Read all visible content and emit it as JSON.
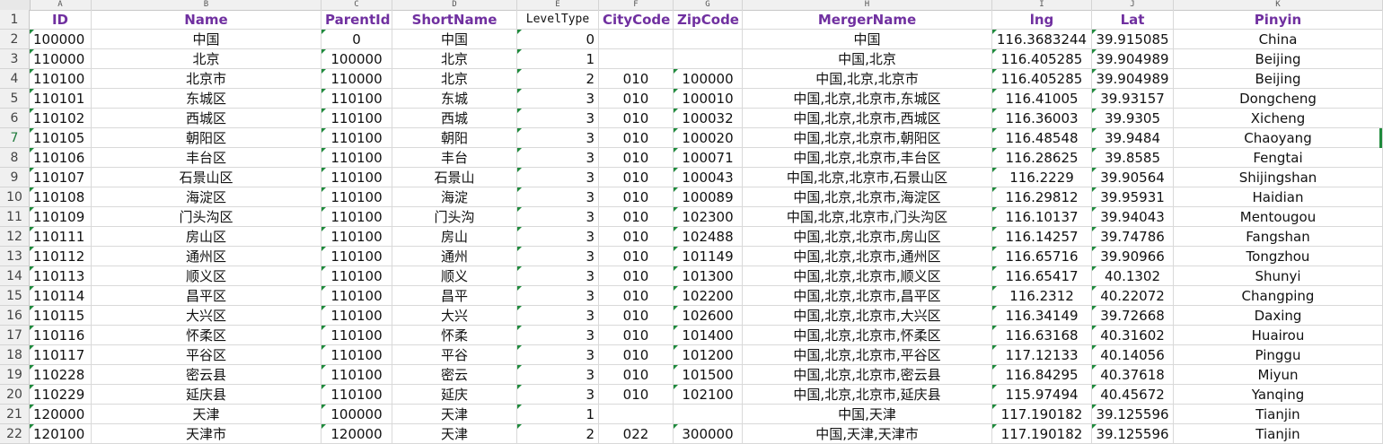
{
  "columns": [
    {
      "letter": "A",
      "name": "ID",
      "align": "l"
    },
    {
      "letter": "B",
      "name": "Name",
      "align": "c"
    },
    {
      "letter": "C",
      "name": "ParentId",
      "align": "c"
    },
    {
      "letter": "D",
      "name": "ShortName",
      "align": "c"
    },
    {
      "letter": "E",
      "name": "LevelType",
      "align": "r"
    },
    {
      "letter": "F",
      "name": "CityCode",
      "align": "c"
    },
    {
      "letter": "G",
      "name": "ZipCode",
      "align": "c"
    },
    {
      "letter": "H",
      "name": "MergerName",
      "align": "c"
    },
    {
      "letter": "I",
      "name": "lng",
      "align": "c"
    },
    {
      "letter": "J",
      "name": "Lat",
      "align": "c"
    },
    {
      "letter": "K",
      "name": "Pinyin",
      "align": "c"
    }
  ],
  "rows": [
    {
      "n": "2",
      "cells": [
        "100000",
        "中国",
        "0",
        "中国",
        "0",
        "",
        "",
        "中国",
        "116.3683244",
        "39.915085",
        "China"
      ]
    },
    {
      "n": "3",
      "cells": [
        "110000",
        "北京",
        "100000",
        "北京",
        "1",
        "",
        "",
        "中国,北京",
        "116.405285",
        "39.904989",
        "Beijing"
      ]
    },
    {
      "n": "4",
      "cells": [
        "110100",
        "北京市",
        "110000",
        "北京",
        "2",
        "010",
        "100000",
        "中国,北京,北京市",
        "116.405285",
        "39.904989",
        "Beijing"
      ]
    },
    {
      "n": "5",
      "cells": [
        "110101",
        "东城区",
        "110100",
        "东城",
        "3",
        "010",
        "100010",
        "中国,北京,北京市,东城区",
        "116.41005",
        "39.93157",
        "Dongcheng"
      ]
    },
    {
      "n": "6",
      "cells": [
        "110102",
        "西城区",
        "110100",
        "西城",
        "3",
        "010",
        "100032",
        "中国,北京,北京市,西城区",
        "116.36003",
        "39.9305",
        "Xicheng"
      ]
    },
    {
      "n": "7",
      "cells": [
        "110105",
        "朝阳区",
        "110100",
        "朝阳",
        "3",
        "010",
        "100020",
        "中国,北京,北京市,朝阳区",
        "116.48548",
        "39.9484",
        "Chaoyang"
      ]
    },
    {
      "n": "8",
      "cells": [
        "110106",
        "丰台区",
        "110100",
        "丰台",
        "3",
        "010",
        "100071",
        "中国,北京,北京市,丰台区",
        "116.28625",
        "39.8585",
        "Fengtai"
      ]
    },
    {
      "n": "9",
      "cells": [
        "110107",
        "石景山区",
        "110100",
        "石景山",
        "3",
        "010",
        "100043",
        "中国,北京,北京市,石景山区",
        "116.2229",
        "39.90564",
        "Shijingshan"
      ]
    },
    {
      "n": "10",
      "cells": [
        "110108",
        "海淀区",
        "110100",
        "海淀",
        "3",
        "010",
        "100089",
        "中国,北京,北京市,海淀区",
        "116.29812",
        "39.95931",
        "Haidian"
      ]
    },
    {
      "n": "11",
      "cells": [
        "110109",
        "门头沟区",
        "110100",
        "门头沟",
        "3",
        "010",
        "102300",
        "中国,北京,北京市,门头沟区",
        "116.10137",
        "39.94043",
        "Mentougou"
      ]
    },
    {
      "n": "12",
      "cells": [
        "110111",
        "房山区",
        "110100",
        "房山",
        "3",
        "010",
        "102488",
        "中国,北京,北京市,房山区",
        "116.14257",
        "39.74786",
        "Fangshan"
      ]
    },
    {
      "n": "13",
      "cells": [
        "110112",
        "通州区",
        "110100",
        "通州",
        "3",
        "010",
        "101149",
        "中国,北京,北京市,通州区",
        "116.65716",
        "39.90966",
        "Tongzhou"
      ]
    },
    {
      "n": "14",
      "cells": [
        "110113",
        "顺义区",
        "110100",
        "顺义",
        "3",
        "010",
        "101300",
        "中国,北京,北京市,顺义区",
        "116.65417",
        "40.1302",
        "Shunyi"
      ]
    },
    {
      "n": "15",
      "cells": [
        "110114",
        "昌平区",
        "110100",
        "昌平",
        "3",
        "010",
        "102200",
        "中国,北京,北京市,昌平区",
        "116.2312",
        "40.22072",
        "Changping"
      ]
    },
    {
      "n": "16",
      "cells": [
        "110115",
        "大兴区",
        "110100",
        "大兴",
        "3",
        "010",
        "102600",
        "中国,北京,北京市,大兴区",
        "116.34149",
        "39.72668",
        "Daxing"
      ]
    },
    {
      "n": "17",
      "cells": [
        "110116",
        "怀柔区",
        "110100",
        "怀柔",
        "3",
        "010",
        "101400",
        "中国,北京,北京市,怀柔区",
        "116.63168",
        "40.31602",
        "Huairou"
      ]
    },
    {
      "n": "18",
      "cells": [
        "110117",
        "平谷区",
        "110100",
        "平谷",
        "3",
        "010",
        "101200",
        "中国,北京,北京市,平谷区",
        "117.12133",
        "40.14056",
        "Pinggu"
      ]
    },
    {
      "n": "19",
      "cells": [
        "110228",
        "密云县",
        "110100",
        "密云",
        "3",
        "010",
        "101500",
        "中国,北京,北京市,密云县",
        "116.84295",
        "40.37618",
        "Miyun"
      ]
    },
    {
      "n": "20",
      "cells": [
        "110229",
        "延庆县",
        "110100",
        "延庆",
        "3",
        "010",
        "102100",
        "中国,北京,北京市,延庆县",
        "115.97494",
        "40.45672",
        "Yanqing"
      ]
    },
    {
      "n": "21",
      "cells": [
        "120000",
        "天津",
        "100000",
        "天津",
        "1",
        "",
        "",
        "中国,天津",
        "117.190182",
        "39.125596",
        "Tianjin"
      ]
    },
    {
      "n": "22",
      "cells": [
        "120100",
        "天津市",
        "120000",
        "天津",
        "2",
        "022",
        "300000",
        "中国,天津,天津市",
        "117.190182",
        "39.125596",
        "Tianjin"
      ]
    }
  ],
  "active_row": "7"
}
